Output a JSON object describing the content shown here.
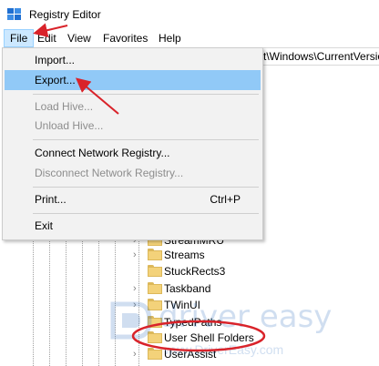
{
  "window": {
    "title": "Registry Editor",
    "icon": "registry-editor-icon"
  },
  "menubar": {
    "items": [
      {
        "label": "File",
        "active": true
      },
      {
        "label": "Edit"
      },
      {
        "label": "View"
      },
      {
        "label": "Favorites"
      },
      {
        "label": "Help"
      }
    ]
  },
  "address_bar": {
    "value": "t\\Windows\\CurrentVersio"
  },
  "file_menu": {
    "items": [
      {
        "label": "Import...",
        "enabled": true
      },
      {
        "label": "Export...",
        "enabled": true,
        "highlighted": true
      },
      {
        "label": "Load Hive...",
        "enabled": false
      },
      {
        "label": "Unload Hive...",
        "enabled": false
      },
      {
        "label": "Connect Network Registry...",
        "enabled": true
      },
      {
        "label": "Disconnect Network Registry...",
        "enabled": false
      },
      {
        "label": "Print...",
        "enabled": true,
        "shortcut": "Ctrl+P"
      },
      {
        "label": "Exit",
        "enabled": true
      }
    ]
  },
  "tree": {
    "nodes": [
      {
        "label": "StreamMRU",
        "expandable": true
      },
      {
        "label": "Streams",
        "expandable": true
      },
      {
        "label": "StuckRects3",
        "expandable": false
      },
      {
        "label": "Taskband",
        "expandable": true
      },
      {
        "label": "TWinUI",
        "expandable": true
      },
      {
        "label": "TypedPaths",
        "expandable": false
      },
      {
        "label": "User Shell Folders",
        "expandable": false,
        "circled": true
      },
      {
        "label": "UserAssist",
        "expandable": true
      }
    ]
  },
  "watermark": {
    "text": "driver easy",
    "url": "www.DriverEasy.com"
  },
  "colors": {
    "menu_highlight": "#91c9f7",
    "menubar_active": "#cce8ff",
    "annotation_red": "#d9232a",
    "folder_yellow": "#f3d27a"
  }
}
